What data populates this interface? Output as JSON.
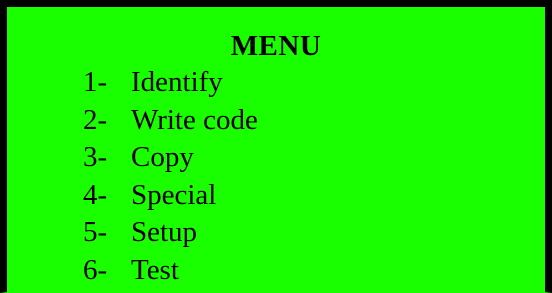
{
  "menu": {
    "title": "MENU",
    "items": [
      {
        "number": "1-",
        "label": "Identify"
      },
      {
        "number": "2-",
        "label": "Write code"
      },
      {
        "number": "3-",
        "label": "Copy"
      },
      {
        "number": "4-",
        "label": "Special"
      },
      {
        "number": "5-",
        "label": "Setup"
      },
      {
        "number": "6-",
        "label": "Test"
      }
    ]
  },
  "colors": {
    "screen_background": "#1aff00",
    "frame": "#000000",
    "text": "#000000"
  }
}
